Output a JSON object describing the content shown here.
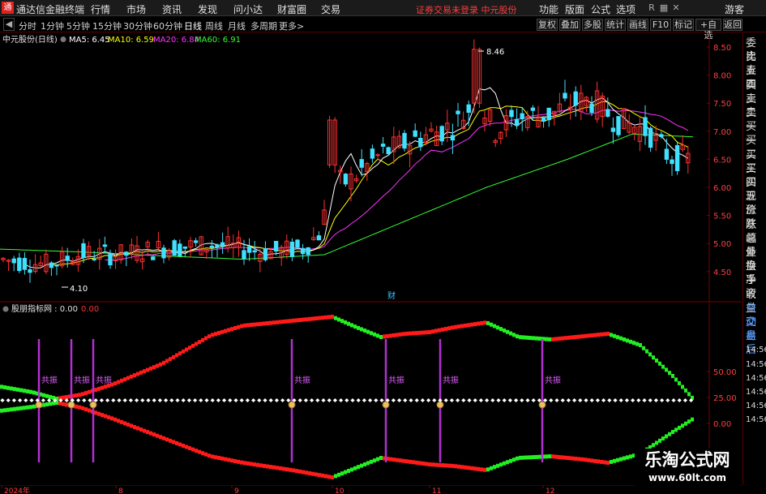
{
  "app": {
    "title": "通达信金融终端",
    "status": "证券交易未登录  中元股份",
    "guest": "游客"
  },
  "menu": [
    "行情",
    "市场",
    "资讯",
    "发现",
    "问小达",
    "财富圈",
    "交易"
  ],
  "right_menu": [
    "功能",
    "版面",
    "公式",
    "选项"
  ],
  "periods": [
    "分时",
    "1分钟",
    "5分钟",
    "15分钟",
    "30分钟",
    "60分钟",
    "日线",
    "周线",
    "月线",
    "多周期",
    "更多>"
  ],
  "active_period": "日线",
  "toolbar": [
    "复权",
    "叠加",
    "多股",
    "统计",
    "画线",
    "F10",
    "标记",
    "+自选",
    "返回"
  ],
  "main": {
    "stock": "中元股份(日线)",
    "ma": [
      {
        "label": "MA5: 6.45",
        "color": "#ffffff"
      },
      {
        "label": "MA10: 6.59",
        "color": "#ffff00"
      },
      {
        "label": "MA20: 6.84",
        "color": "#ff33ff"
      },
      {
        "label": "MA60: 6.91",
        "color": "#33ff33"
      }
    ],
    "high_label": "8.46",
    "low_label": "4.10",
    "cai": "财",
    "yticks": [
      "8.50",
      "8.00",
      "7.50",
      "7.00",
      "6.50",
      "6.00",
      "5.50",
      "5.00",
      "4.50"
    ]
  },
  "indicator": {
    "name": "股朋指标网 : 0.00",
    "value": "0.00",
    "yticks": [
      "50.00",
      "25.00",
      "0.00"
    ],
    "resonance_label": "共振",
    "resonance_xs": [
      48,
      88,
      115,
      360,
      476,
      543,
      669
    ]
  },
  "sidebar": [
    "委比",
    "卖五",
    "卖四",
    "卖三",
    "卖二",
    "卖一",
    "买一",
    "买二",
    "买三",
    "买四",
    "买五",
    "现价",
    "涨跌",
    "涨幅",
    "总量",
    "外盘",
    "换手",
    "净资",
    "收益",
    "自动",
    "交易",
    "盘后",
    "14:56",
    "14:56",
    "14:56",
    "14:56",
    "14:56",
    "14:56"
  ],
  "xaxis": [
    "2024年",
    "8",
    "9",
    "10",
    "11",
    "12"
  ],
  "watermark": {
    "line1": "乐淘公式网",
    "line2": "www.60lt.com"
  },
  "chart_data": [
    {
      "type": "candlestick",
      "title": "中元股份(日线)",
      "ylim": [
        4.1,
        8.6
      ],
      "x": [
        "2024年",
        "8",
        "9",
        "10",
        "11",
        "12"
      ],
      "series": [
        {
          "name": "MA5",
          "last": 6.45
        },
        {
          "name": "MA10",
          "last": 6.59
        },
        {
          "name": "MA20",
          "last": 6.84
        },
        {
          "name": "MA60",
          "last": 6.91
        }
      ],
      "annotations": [
        "8.46",
        "4.10"
      ]
    },
    {
      "type": "area",
      "title": "股朋指标网",
      "yticks": [
        50,
        25,
        0
      ]
    }
  ]
}
